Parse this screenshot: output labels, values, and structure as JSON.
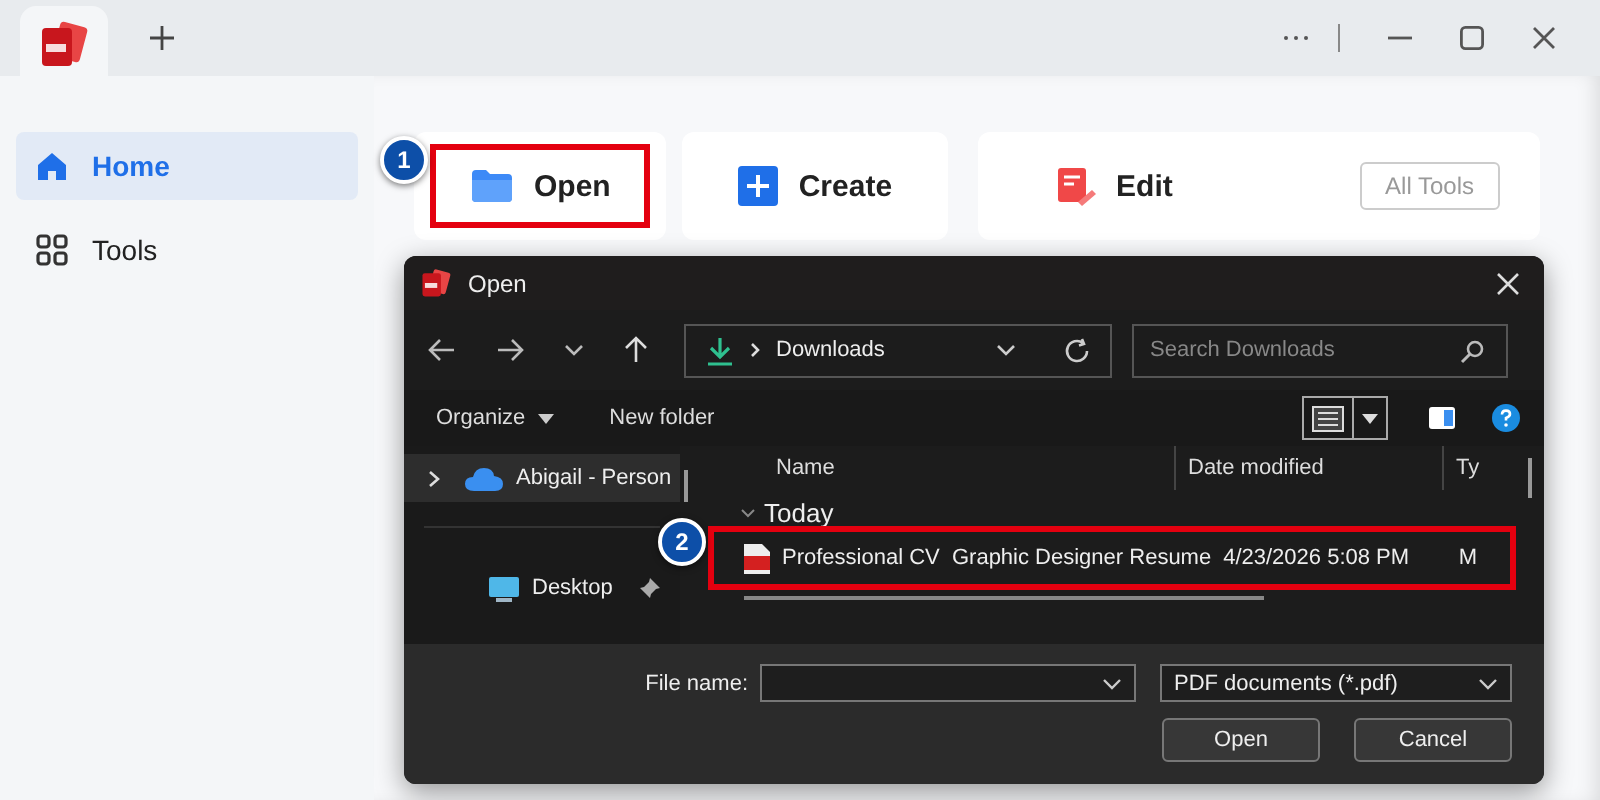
{
  "sidebar": {
    "items": [
      {
        "label": "Home",
        "selected": true
      },
      {
        "label": "Tools",
        "selected": false
      }
    ]
  },
  "actions": [
    {
      "label": "Open"
    },
    {
      "label": "Create"
    },
    {
      "label": "Edit"
    }
  ],
  "all_tools": "All Tools",
  "dialog": {
    "title": "Open",
    "path": "Downloads",
    "search": {
      "placeholder": "Search Downloads"
    },
    "commands": [
      "Organize",
      "New folder"
    ],
    "nav_items": [
      {
        "label": "Abigail - Person",
        "selected": true,
        "expandable": true,
        "pinned": false
      },
      {
        "label": "Desktop",
        "selected": false,
        "expandable": false,
        "pinned": true
      }
    ],
    "columns": [
      "Name",
      "Date modified",
      "Ty"
    ],
    "group": "Today",
    "files": [
      {
        "name": "Professional CV  Graphic Designer Resume",
        "date": "4/23/2026 5:08 PM",
        "column_3": "M"
      }
    ],
    "file_name_label": "File name:",
    "filter": "PDF documents (*.pdf)",
    "buttons": [
      "Open",
      "Cancel"
    ]
  },
  "callouts": [
    {
      "number": "1"
    },
    {
      "number": "2"
    }
  ]
}
